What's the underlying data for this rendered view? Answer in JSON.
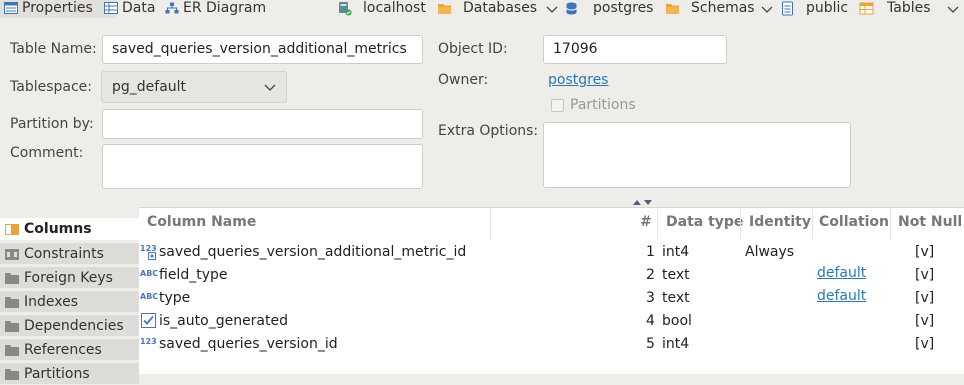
{
  "tabs": [
    {
      "label": "Properties",
      "icon": "properties-icon",
      "active": true
    },
    {
      "label": "Data",
      "icon": "data-grid-icon",
      "active": false
    },
    {
      "label": "ER Diagram",
      "icon": "er-diagram-icon",
      "active": false
    }
  ],
  "breadcrumb": {
    "host": "localhost",
    "databases": "Databases",
    "database": "postgres",
    "schemas": "Schemas",
    "schema": "public",
    "tables": "Tables"
  },
  "form": {
    "table_name_label": "Table Name:",
    "table_name_value": "saved_queries_version_additional_metrics",
    "tablespace_label": "Tablespace:",
    "tablespace_value": "pg_default",
    "partition_by_label": "Partition by:",
    "comment_label": "Comment:",
    "object_id_label": "Object ID:",
    "object_id_value": "17096",
    "owner_label": "Owner:",
    "owner_value": "postgres",
    "partitions_label": "Partitions",
    "extra_options_label": "Extra Options:"
  },
  "sidebar": {
    "items": [
      {
        "label": "Columns",
        "active": true
      },
      {
        "label": "Constraints",
        "active": false
      },
      {
        "label": "Foreign Keys",
        "active": false
      },
      {
        "label": "Indexes",
        "active": false
      },
      {
        "label": "Dependencies",
        "active": false
      },
      {
        "label": "References",
        "active": false
      },
      {
        "label": "Partitions",
        "active": false
      }
    ]
  },
  "columns_table": {
    "headers": {
      "name": "Column Name",
      "num": "#",
      "type": "Data type",
      "identity": "Identity",
      "collation": "Collation",
      "not_null": "Not Null"
    },
    "rows": [
      {
        "type_icon": "numeric-key-icon",
        "icon_text": "123",
        "name": "saved_queries_version_additional_metric_id",
        "num": "1",
        "data_type": "int4",
        "identity": "Always",
        "collation": "",
        "not_null": "[v]"
      },
      {
        "type_icon": "text-type-icon",
        "icon_text": "ABC",
        "name": "field_type",
        "num": "2",
        "data_type": "text",
        "identity": "",
        "collation": "default",
        "not_null": "[v]"
      },
      {
        "type_icon": "text-type-icon",
        "icon_text": "ABC",
        "name": "type",
        "num": "3",
        "data_type": "text",
        "identity": "",
        "collation": "default",
        "not_null": "[v]"
      },
      {
        "type_icon": "boolean-check-icon",
        "icon_text": "",
        "name": "is_auto_generated",
        "num": "4",
        "data_type": "bool",
        "identity": "",
        "collation": "",
        "not_null": "[v]"
      },
      {
        "type_icon": "numeric-icon",
        "icon_text": "123",
        "name": "saved_queries_version_id",
        "num": "5",
        "data_type": "int4",
        "identity": "",
        "collation": "",
        "not_null": "[v]"
      }
    ]
  },
  "colors": {
    "accent": "#2a79b3",
    "folder": "#e8a33a",
    "background": "#efedea"
  }
}
